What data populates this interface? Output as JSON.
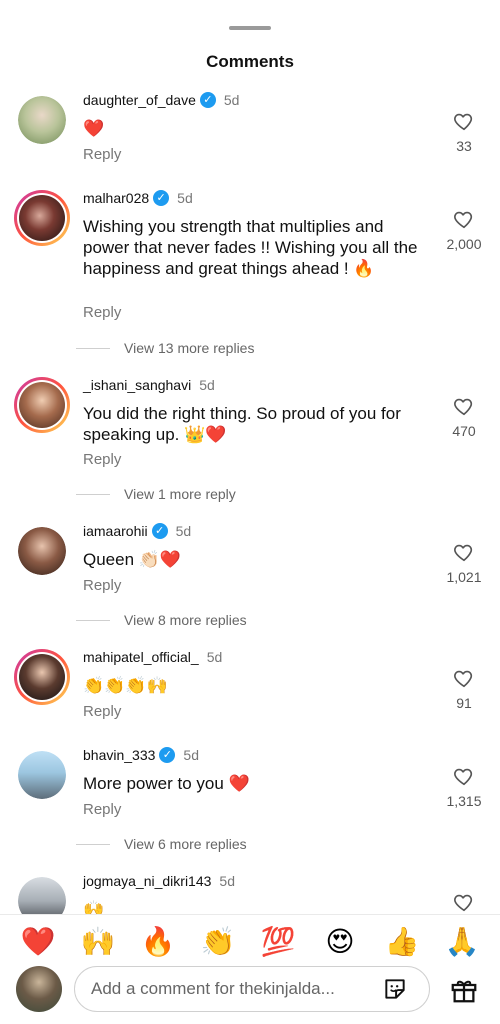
{
  "header": {
    "title": "Comments"
  },
  "comments": [
    {
      "username": "daughter_of_dave",
      "verified": true,
      "time": "5d",
      "text": "❤️",
      "reply_label": "Reply",
      "likes": "33"
    },
    {
      "username": "malhar028",
      "verified": true,
      "time": "5d",
      "text": "Wishing you strength that multiplies and power that never fades !! Wishing you all the happiness and great things ahead ! 🔥",
      "reply_label": "Reply",
      "likes": "2,000",
      "view_more": "View 13 more replies"
    },
    {
      "username": "_ishani_sanghavi",
      "verified": false,
      "time": "5d",
      "text": "You did the right thing. So proud of you for speaking up. 👑❤️",
      "reply_label": "Reply",
      "likes": "470",
      "view_more": "View 1 more reply"
    },
    {
      "username": "iamaarohii",
      "verified": true,
      "time": "5d",
      "text": "Queen 👏🏻❤️",
      "reply_label": "Reply",
      "likes": "1,021",
      "view_more": "View 8 more replies"
    },
    {
      "username": "mahipatel_official_",
      "verified": false,
      "time": "5d",
      "text": "👏👏👏🙌",
      "reply_label": "Reply",
      "likes": "91"
    },
    {
      "username": "bhavin_333",
      "verified": true,
      "time": "5d",
      "text": "More power to you ❤️",
      "reply_label": "Reply",
      "likes": "1,315",
      "view_more": "View 6 more replies"
    },
    {
      "username": "jogmaya_ni_dikri143",
      "verified": false,
      "time": "5d",
      "text": "🙌",
      "reply_label": "",
      "likes": ""
    }
  ],
  "emoji_bar": [
    "❤️",
    "🙌",
    "🔥",
    "👏",
    "💯",
    "😍",
    "👍",
    "🙏"
  ],
  "composer": {
    "placeholder": "Add a comment for thekinjalda..."
  },
  "colors": {
    "accent_verified": "#1d9bf0",
    "story_ring_start": "#c837ab",
    "story_ring_end": "#ffdd55"
  },
  "icons": {
    "like": "heart-outline-icon",
    "sticker": "sticker-icon",
    "gift": "gift-icon"
  }
}
